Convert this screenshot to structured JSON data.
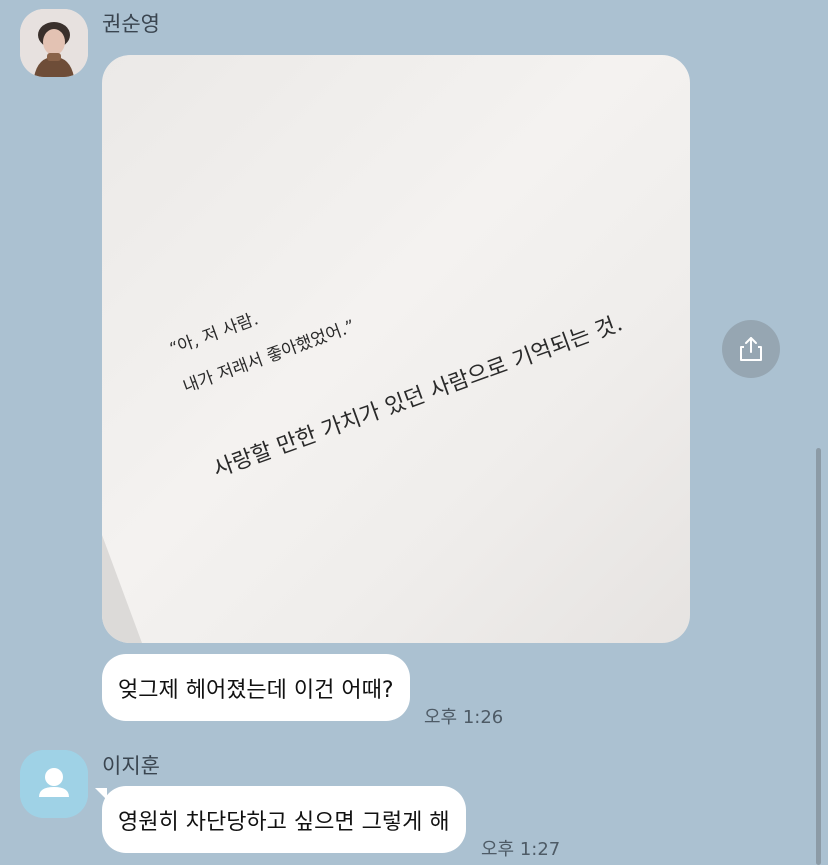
{
  "messages": [
    {
      "sender": "권순영",
      "photo": {
        "quote_line1": "“아, 저 사람.",
        "quote_line2": "내가 저래서 좋아했었어.”",
        "quote_line3": "사랑할 만한 가치가 있던 사람으로 기억되는 것."
      },
      "text": "엊그제 헤어졌는데 이건 어때?",
      "time": "오후 1:26"
    },
    {
      "sender": "이지훈",
      "text": "영원히 차단당하고 싶으면 그렇게 해",
      "time": "오후 1:27"
    }
  ],
  "icons": {
    "share": "share-icon",
    "default_avatar": "person-icon"
  },
  "colors": {
    "background": "#abc1d1",
    "bubble": "#ffffff",
    "share_button": "#96a6b2",
    "default_avatar": "#9fd2e6"
  }
}
